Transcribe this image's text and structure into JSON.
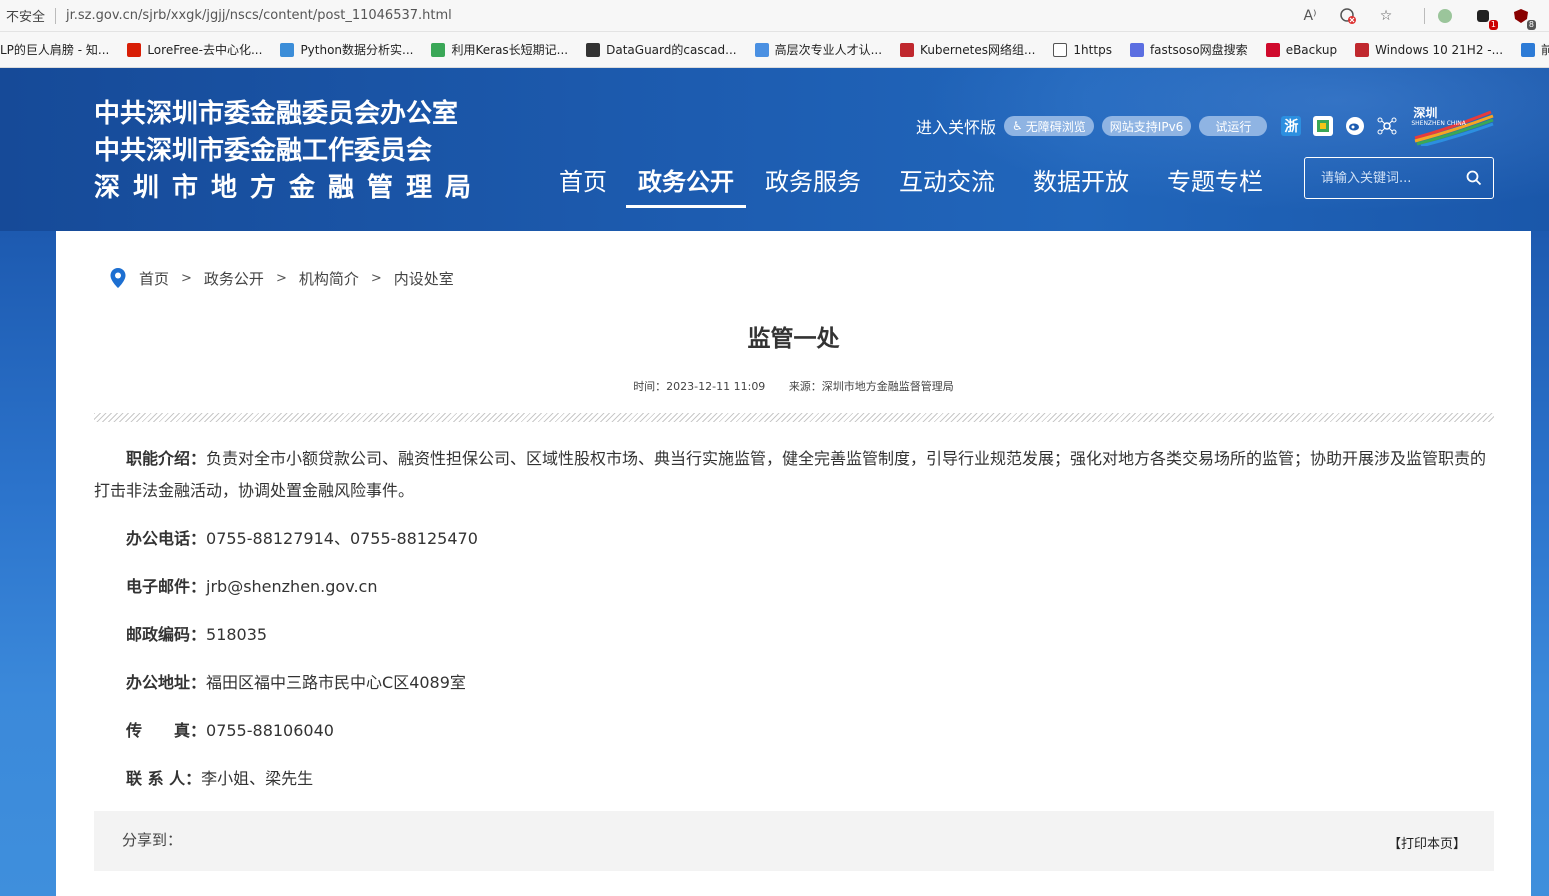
{
  "browser": {
    "insecure_label": "不安全",
    "url": "jr.sz.gov.cn/sjrb/xxgk/jgjj/nscs/content/post_11046537.html",
    "badges": {
      "ext1": "1",
      "ext2": "8"
    }
  },
  "bookmarks": [
    {
      "label": "LP的巨人肩膀 - 知...",
      "icon": "bookmark-icon",
      "color": "#1772f6"
    },
    {
      "label": "LoreFree-去中心化...",
      "icon": "lorefree-icon",
      "color": "#d81e06"
    },
    {
      "label": "Python数据分析实...",
      "icon": "python-icon",
      "color": "#3b8dd8"
    },
    {
      "label": "利用Keras长短期记...",
      "icon": "code-icon",
      "color": "#3aa757"
    },
    {
      "label": "DataGuard的cascad...",
      "icon": "dataguard-icon",
      "color": "#333333"
    },
    {
      "label": "高层次专业人才认...",
      "icon": "gear-blue-icon",
      "color": "#4a90e2"
    },
    {
      "label": "Kubernetes网络组...",
      "icon": "site51-icon",
      "color": "#c0282e"
    },
    {
      "label": "1https",
      "icon": "page-icon",
      "color": "#ffffff"
    },
    {
      "label": "fastsoso网盘搜索",
      "icon": "search-circle-icon",
      "color": "#5b6ee1"
    },
    {
      "label": "eBackup",
      "icon": "huawei-icon",
      "color": "#cf0a2c"
    },
    {
      "label": "Windows 10 21H2 -...",
      "icon": "diamond-icon",
      "color": "#c0282e"
    },
    {
      "label": "前言 — 动手学",
      "icon": "edit-icon",
      "color": "#2d7bd6"
    }
  ],
  "header": {
    "logo_lines": [
      "中共深圳市委金融委员会办公室",
      "中共深圳市委金融工作委员会",
      "深圳市地方金融管理局"
    ],
    "care_link": "进入关怀版",
    "pills": [
      "无障碍浏览",
      "网站支持IPv6",
      "试运行"
    ],
    "sz_logo_text": "深圳",
    "sz_logo_sub": "SHENZHEN CHINA",
    "nav": [
      "首页",
      "政务公开",
      "政务服务",
      "互动交流",
      "数据开放",
      "专题专栏"
    ],
    "search_placeholder": "请输入关键词..."
  },
  "breadcrumb": [
    "首页",
    "政务公开",
    "机构简介",
    "内设处室"
  ],
  "breadcrumb_sep": ">",
  "article": {
    "title": "监管一处",
    "time": "时间：2023-12-11 11:09",
    "source": "来源：深圳市地方金融监督管理局",
    "fields": {
      "duty_label": "职能介绍：",
      "duty_text": "负责对全市小额贷款公司、融资性担保公司、区域性股权市场、典当行实施监管，健全完善监管制度，引导行业规范发展；强化对地方各类交易场所的监管；协助开展涉及监管职责的打击非法金融活动，协调处置金融风险事件。",
      "phone_label": "办公电话：",
      "phone": "0755-88127914、0755-88125470",
      "email_label": "电子邮件：",
      "email": "jrb@shenzhen.gov.cn",
      "postcode_label": "邮政编码：",
      "postcode": "518035",
      "address_label": "办公地址：",
      "address": "福田区福中三路市民中心C区4089室",
      "fax_label": "传　　真：",
      "fax": "0755-88106040",
      "contact_label": "联 系 人：",
      "contact": "李小姐、梁先生"
    }
  },
  "share": {
    "label": "分享到：",
    "print": "【打印本页】"
  }
}
